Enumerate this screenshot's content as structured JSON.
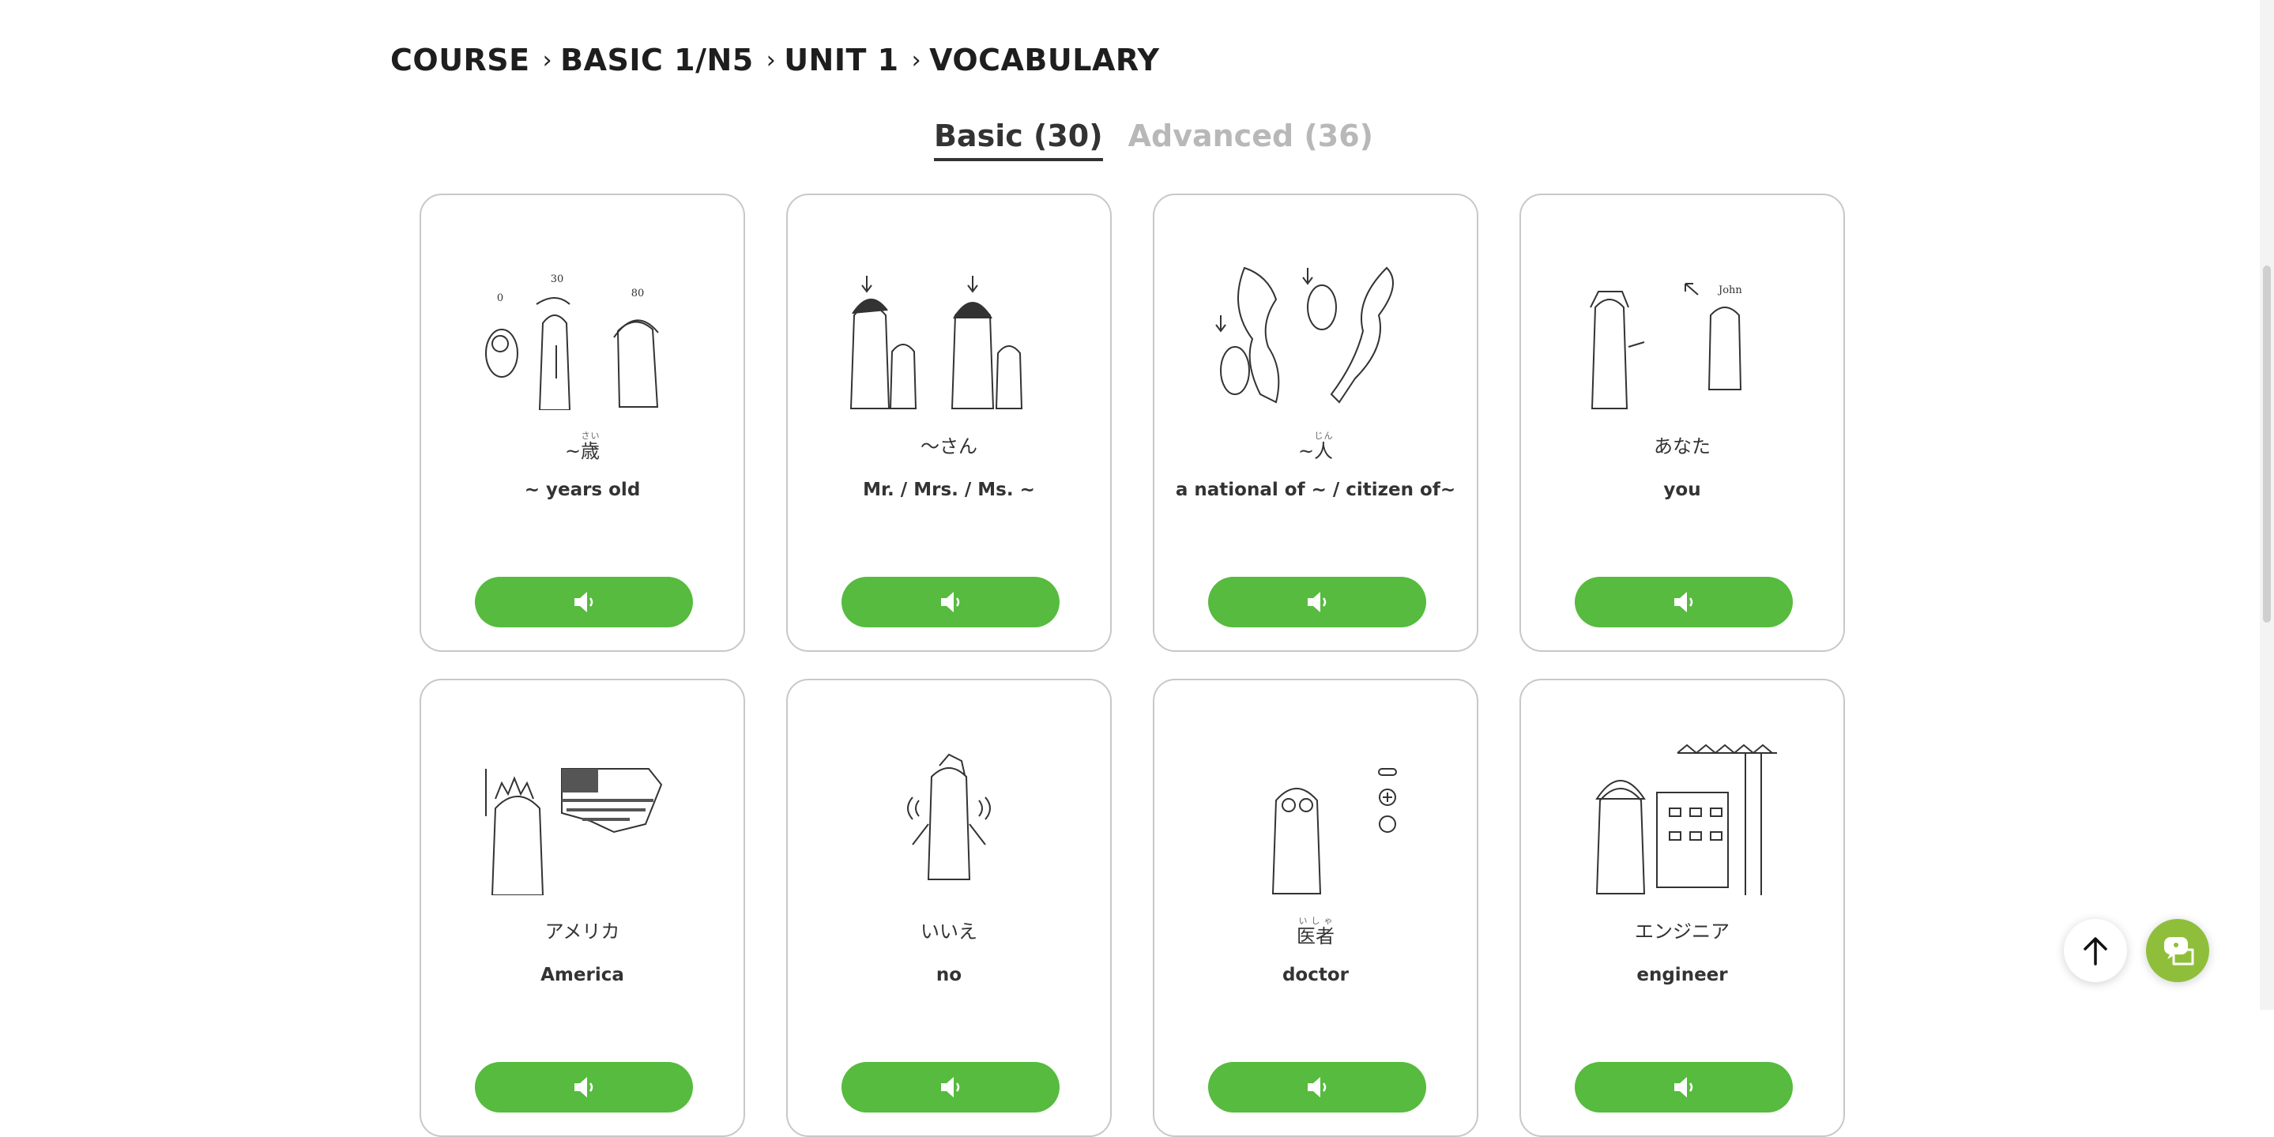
{
  "breadcrumb": {
    "items": [
      "COURSE",
      "BASIC 1/N5",
      "UNIT 1",
      "VOCABULARY"
    ],
    "separator": "›"
  },
  "tabs": [
    {
      "label": "Basic (30)",
      "active": true
    },
    {
      "label": "Advanced (36)",
      "active": false
    }
  ],
  "colors": {
    "accent": "#56bb3e",
    "chat_button": "#8fbf3a",
    "card_border": "#c8c8c8",
    "inactive_tab": "#b8b8b8"
  },
  "cards": [
    {
      "jp_prefix": "~",
      "jp_kanji": "歳",
      "jp_ruby": "さい",
      "jp_suffix": "",
      "en": "~ years old",
      "illustration": "ages-0-30-80-icon",
      "ages": [
        "0",
        "30",
        "80"
      ]
    },
    {
      "jp_prefix": "～さん",
      "jp_kanji": "",
      "jp_ruby": "",
      "jp_suffix": "",
      "en": "Mr. / Mrs. / Ms. ~",
      "illustration": "people-honorific-icon"
    },
    {
      "jp_prefix": "~",
      "jp_kanji": "人",
      "jp_ruby": "じん",
      "jp_suffix": "",
      "en": "a national of ~ / citizen of~",
      "illustration": "maps-nationality-icon"
    },
    {
      "jp_prefix": "あなた",
      "jp_kanji": "",
      "jp_ruby": "",
      "jp_suffix": "",
      "en": "you",
      "illustration": "pointing-you-icon",
      "name_tag": "John"
    },
    {
      "jp_prefix": "アメリカ",
      "jp_kanji": "",
      "jp_ruby": "",
      "jp_suffix": "",
      "en": "America",
      "illustration": "america-flag-icon"
    },
    {
      "jp_prefix": "いいえ",
      "jp_kanji": "",
      "jp_ruby": "",
      "jp_suffix": "",
      "en": "no",
      "illustration": "shaking-head-icon"
    },
    {
      "jp_prefix": "",
      "jp_kanji": "医者",
      "jp_ruby": "いしゃ",
      "jp_suffix": "",
      "en": "doctor",
      "illustration": "doctor-icon"
    },
    {
      "jp_prefix": "エンジニア",
      "jp_kanji": "",
      "jp_ruby": "",
      "jp_suffix": "",
      "en": "engineer",
      "illustration": "engineer-icon"
    }
  ],
  "audio_icon": "speaker-icon",
  "floating": {
    "top_icon": "arrow-up-icon",
    "chat_icon": "chat-icon"
  }
}
